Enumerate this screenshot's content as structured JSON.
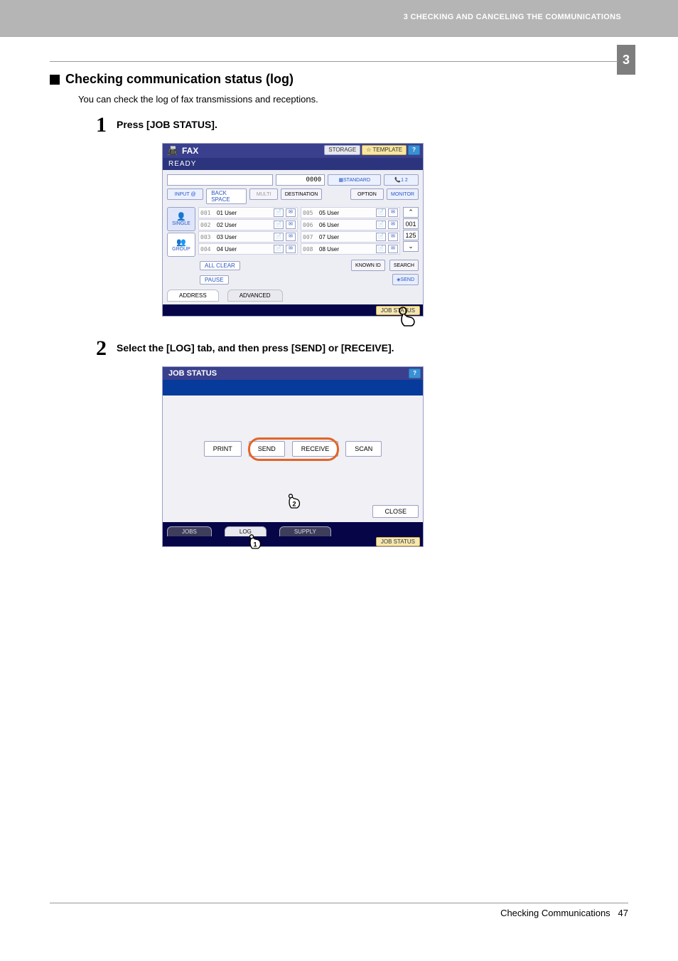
{
  "header": {
    "chapter_label": "3 CHECKING AND CANCELING THE COMMUNICATIONS",
    "chapter_num": "3"
  },
  "section": {
    "title": "Checking communication status (log)",
    "intro": "You can check the log of fax transmissions and receptions."
  },
  "steps": [
    {
      "num": "1",
      "text": "Press [JOB STATUS]."
    },
    {
      "num": "2",
      "text": "Select the [LOG] tab, and then press [SEND] or [RECEIVE]."
    }
  ],
  "fax": {
    "title": "FAX",
    "storage_btn": "STORAGE",
    "template_btn": "TEMPLATE",
    "help": "?",
    "status": "READY",
    "counter_value": "0000",
    "standard_btn": "STANDARD",
    "line_indicator": "1  2",
    "row2": {
      "input_btn": "INPUT @",
      "backspace": "BACK SPACE",
      "multi": "MULTI",
      "destination": "DESTINATION",
      "option": "OPTION",
      "monitor": "MONITOR"
    },
    "side_tabs": {
      "single": "SINGLE",
      "group": "GROUP"
    },
    "left_users": [
      {
        "n": "001",
        "u": "01 User"
      },
      {
        "n": "002",
        "u": "02 User"
      },
      {
        "n": "003",
        "u": "03 User"
      },
      {
        "n": "004",
        "u": "04 User"
      }
    ],
    "right_users": [
      {
        "n": "005",
        "u": "05 User"
      },
      {
        "n": "006",
        "u": "06 User"
      },
      {
        "n": "007",
        "u": "07 User"
      },
      {
        "n": "008",
        "u": "08 User"
      }
    ],
    "scroll": {
      "top": "001",
      "count": "125"
    },
    "all_clear": "ALL CLEAR",
    "pause": "PAUSE",
    "known_id": "KNOWN ID",
    "search": "SEARCH",
    "send": "SEND",
    "tabs": {
      "address": "ADDRESS",
      "advanced": "ADVANCED"
    },
    "job_status_btn": "JOB STATUS"
  },
  "job": {
    "title": "JOB STATUS",
    "help": "?",
    "buttons": {
      "print": "PRINT",
      "send": "SEND",
      "receive": "RECEIVE",
      "scan": "SCAN"
    },
    "close": "CLOSE",
    "tabs": {
      "jobs": "JOBS",
      "log": "LOG",
      "supply": "SUPPLY"
    },
    "job_status_btn": "JOB STATUS"
  },
  "footer": {
    "text": "Checking Communications",
    "page": "47"
  }
}
